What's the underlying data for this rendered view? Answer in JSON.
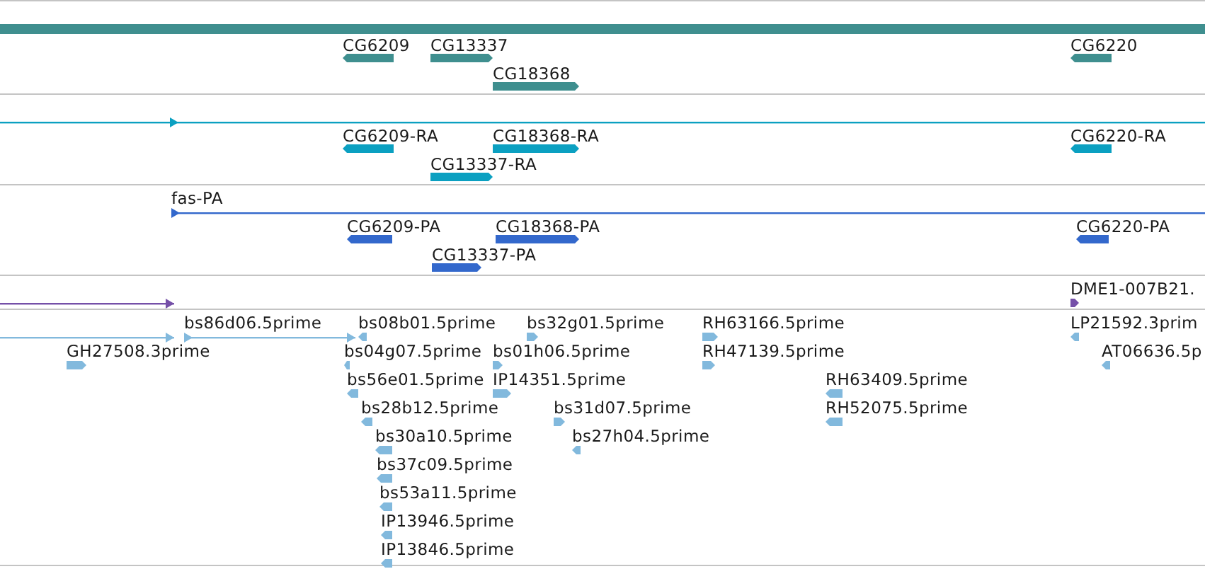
{
  "tracks": [
    {
      "color": "#3f8f8f",
      "features": [
        {
          "kind": "band"
        },
        {
          "kind": "gene",
          "label": "CG6209",
          "reverse": true
        },
        {
          "kind": "gene",
          "label": "CG13337",
          "reverse": false
        },
        {
          "kind": "gene",
          "label": "CG18368",
          "reverse": false
        },
        {
          "kind": "gene",
          "label": "CG6220",
          "reverse": true
        }
      ]
    },
    {
      "color": "#0ba0c1",
      "features": [
        {
          "kind": "span",
          "reverse": false
        },
        {
          "kind": "gene",
          "label": "CG6209-RA",
          "reverse": true
        },
        {
          "kind": "gene",
          "label": "CG18368-RA",
          "reverse": false
        },
        {
          "kind": "gene",
          "label": "CG13337-RA",
          "reverse": false
        },
        {
          "kind": "gene",
          "label": "CG6220-RA",
          "reverse": true
        }
      ]
    },
    {
      "color": "#3368cc",
      "features": [
        {
          "kind": "span",
          "label": "fas-PA",
          "reverse": false
        },
        {
          "kind": "gene",
          "label": "CG6209-PA",
          "reverse": true
        },
        {
          "kind": "gene",
          "label": "CG18368-PA",
          "reverse": false
        },
        {
          "kind": "gene",
          "label": "CG13337-PA",
          "reverse": false
        },
        {
          "kind": "gene",
          "label": "CG6220-PA",
          "reverse": true
        }
      ]
    },
    {
      "color": "#7550a8",
      "features": [
        {
          "kind": "span",
          "reverse": false
        },
        {
          "kind": "gene",
          "label": "DME1-007B21.",
          "reverse": false
        }
      ]
    },
    {
      "color": "#82b9dd",
      "features": [
        {
          "kind": "span",
          "reverse": false
        },
        {
          "kind": "span",
          "label": "bs86d06.5prime",
          "reverse": false
        },
        {
          "kind": "gene",
          "label": "bs08b01.5prime",
          "reverse": true
        },
        {
          "kind": "gene",
          "label": "bs32g01.5prime",
          "reverse": false
        },
        {
          "kind": "gene",
          "label": "RH63166.5prime",
          "reverse": false
        },
        {
          "kind": "gene",
          "label": "LP21592.3prim",
          "reverse": true
        },
        {
          "kind": "gene",
          "label": "GH27508.3prime",
          "reverse": false
        },
        {
          "kind": "gene",
          "label": "bs04g07.5prime",
          "reverse": true
        },
        {
          "kind": "gene",
          "label": "bs01h06.5prime",
          "reverse": false
        },
        {
          "kind": "gene",
          "label": "RH47139.5prime",
          "reverse": false
        },
        {
          "kind": "gene",
          "label": "AT06636.5p",
          "reverse": true
        },
        {
          "kind": "gene",
          "label": "bs56e01.5prime",
          "reverse": true
        },
        {
          "kind": "gene",
          "label": "IP14351.5prime",
          "reverse": false
        },
        {
          "kind": "gene",
          "label": "RH63409.5prime",
          "reverse": true
        },
        {
          "kind": "gene",
          "label": "bs28b12.5prime",
          "reverse": true
        },
        {
          "kind": "gene",
          "label": "bs31d07.5prime",
          "reverse": false
        },
        {
          "kind": "gene",
          "label": "RH52075.5prime",
          "reverse": true
        },
        {
          "kind": "gene",
          "label": "bs30a10.5prime",
          "reverse": true
        },
        {
          "kind": "gene",
          "label": "bs27h04.5prime",
          "reverse": true
        },
        {
          "kind": "gene",
          "label": "bs37c09.5prime",
          "reverse": true
        },
        {
          "kind": "gene",
          "label": "bs53a11.5prime",
          "reverse": true
        },
        {
          "kind": "gene",
          "label": "IP13946.5prime",
          "reverse": true
        },
        {
          "kind": "gene",
          "label": "IP13846.5prime",
          "reverse": true
        }
      ]
    }
  ]
}
